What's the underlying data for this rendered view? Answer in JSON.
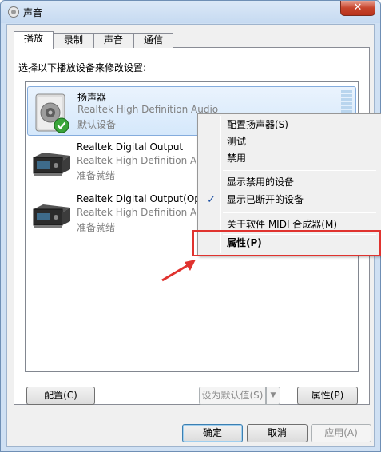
{
  "window": {
    "title": "声音",
    "close_label": "✕"
  },
  "tabs": [
    {
      "label": "播放",
      "active": true
    },
    {
      "label": "录制",
      "active": false
    },
    {
      "label": "声音",
      "active": false
    },
    {
      "label": "通信",
      "active": false
    }
  ],
  "instruction": "选择以下播放设备来修改设置:",
  "devices": [
    {
      "name": "扬声器",
      "driver": "Realtek High Definition Audio",
      "status": "默认设备",
      "selected": true,
      "icon": "speaker-icon",
      "default_badge": true
    },
    {
      "name": "Realtek Digital Output",
      "driver": "Realtek High Definition Audio",
      "status": "准备就绪",
      "selected": false,
      "icon": "digital-output-icon"
    },
    {
      "name": "Realtek Digital Output(Optical)",
      "driver": "Realtek High Definition Audio",
      "status": "准备就绪",
      "selected": false,
      "icon": "digital-output-icon"
    }
  ],
  "context_menu": {
    "items": [
      {
        "label": "配置扬声器(S)"
      },
      {
        "label": "测试"
      },
      {
        "label": "禁用"
      },
      {
        "label": "显示禁用的设备"
      },
      {
        "label": "显示已断开的设备",
        "checked": true
      },
      {
        "label": "关于软件 MIDI 合成器(M)"
      },
      {
        "label": "属性(P)",
        "bold": true
      }
    ],
    "check_mark": "✓"
  },
  "buttons": {
    "configure": "配置(C)",
    "set_default": "设为默认值(S)",
    "set_default_arrow": "▼",
    "properties": "属性(P)",
    "ok": "确定",
    "cancel": "取消",
    "apply": "应用(A)"
  },
  "colors": {
    "highlight_box": "#e0332f",
    "selection": "#d5e8fb",
    "check": "#1b4fa3"
  }
}
